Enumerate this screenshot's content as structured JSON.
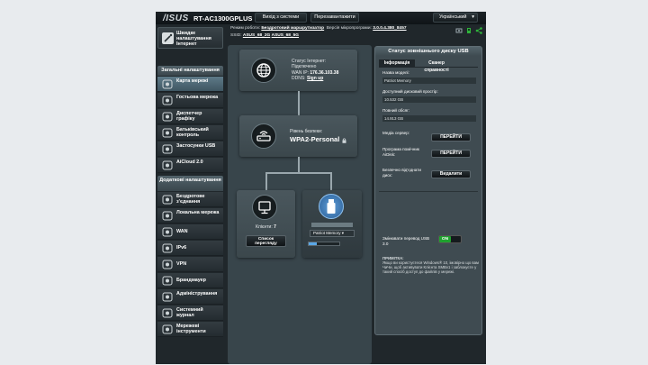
{
  "header": {
    "brand": "/ISUS",
    "model": "RT-AC1300GPLUS",
    "logout_label": "Вихід з системи",
    "reboot_label": "Перезавантажити",
    "language": "Український"
  },
  "infobar": {
    "mode_label": "Режим роботи:",
    "mode_value": "Бездротовий маршрутизатор",
    "firmware_label": "Версія мікропрограми:",
    "firmware_value": "3.0.0.4.380_8457",
    "ssid_label": "SSID:",
    "ssid_1": "ASUS_68_2G",
    "ssid_2": "ASUS_68_5G"
  },
  "sidebar": {
    "quick_label": "Швидке налаштування Інтернет",
    "general_header": "Загальні налаштування",
    "general_items": [
      {
        "label": "Карта мережі",
        "icon": "network-map-icon"
      },
      {
        "label": "Гостьова мережа",
        "icon": "guest-network-icon"
      },
      {
        "label": "Диспетчер графіку",
        "icon": "traffic-manager-icon"
      },
      {
        "label": "Батьківський контроль",
        "icon": "parental-control-icon"
      },
      {
        "label": "Застосунки USB",
        "icon": "usb-apps-icon"
      },
      {
        "label": "AiCloud 2.0",
        "icon": "cloud-icon"
      }
    ],
    "advanced_header": "Додаткові налаштування",
    "advanced_items": [
      {
        "label": "Бездротове з'єднання",
        "icon": "wireless-icon"
      },
      {
        "label": "Локальна мережа",
        "icon": "lan-icon"
      },
      {
        "label": "WAN",
        "icon": "wan-icon"
      },
      {
        "label": "IPv6",
        "icon": "ipv6-icon"
      },
      {
        "label": "VPN",
        "icon": "vpn-icon"
      },
      {
        "label": "Брандмауер",
        "icon": "firewall-icon"
      },
      {
        "label": "Адміністрування",
        "icon": "admin-icon"
      },
      {
        "label": "Системний журнал",
        "icon": "system-log-icon"
      },
      {
        "label": "Мережеві інструменти",
        "icon": "network-tools-icon"
      }
    ]
  },
  "map": {
    "internet": {
      "status_label": "Статус Інтернет:",
      "status_value": "Підключено",
      "wan_ip_label": "WAN IP:",
      "wan_ip_value": "176.36.103.38",
      "ddns_label": "DDNS:",
      "ddns_value": "Sign up"
    },
    "router": {
      "security_label": "Рівень безпеки:",
      "security_value": "WPA2-Personal"
    },
    "clients": {
      "label": "Клієнти:",
      "count": "7",
      "button": "Список перегляду"
    },
    "usb": {
      "device_select": "Patriot Memory",
      "usage_fraction": 0.25
    }
  },
  "usb_panel": {
    "title": "Статус зовнішнього диску USB",
    "tab_info": "Інформація",
    "tab_health": "Сканер справності",
    "model_label": "Назва моделі:",
    "model_value": "Patriot Memory",
    "free_label": "Доступний дисковий простір:",
    "free_value": "10.532 GB",
    "total_label": "Повний обсяг:",
    "total_value": "14.913 GB",
    "media_label": "Медіа сервер:",
    "aidisk_label": "Програма помічник AiDisk:",
    "eject_label": "Безпечно від'єднати диск:",
    "goto_btn": "ПЕРЕЙТИ",
    "eject_btn": "Видалити",
    "usb3_label": "Змінювати перевод USB 3.0",
    "usb3_state": "ON",
    "note_title": "ПРИМІТКА:",
    "note_text": "Якщо ви користуєтеся Windows® 10, імовірно що вам ЧиЧи, щоб активувати Клієнта SMBv1 і заблокуєте у такий спосіб доступ до файлів у мережі."
  }
}
